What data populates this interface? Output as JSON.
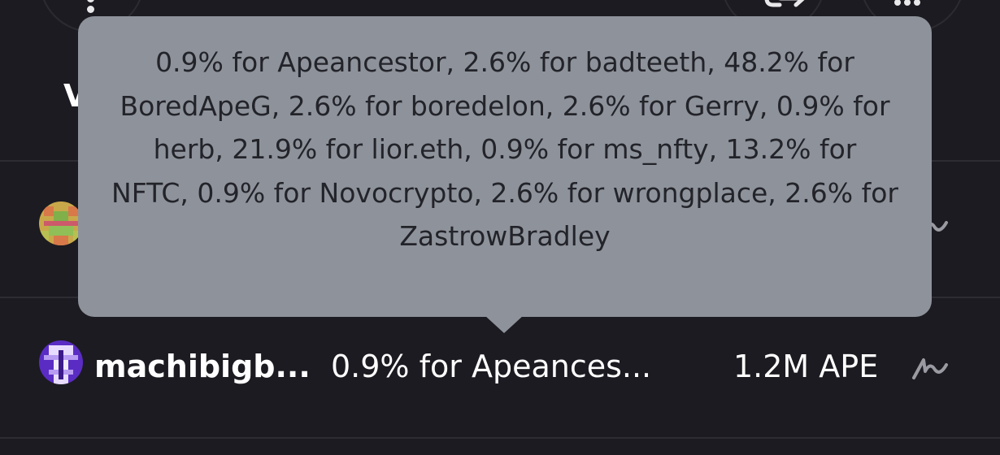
{
  "header": {
    "partial_label": "V"
  },
  "tooltip": {
    "text": "0.9% for Apeancestor, 2.6% for badteeth, 48.2% for BoredApeG, 2.6% for boredelon, 2.6% for Gerry, 0.9% for herb, 21.9% for lior.eth, 0.9% for ms_nfty, 13.2% for NFTC, 0.9% for Novocrypto, 2.6% for wrongplace, 2.6% for ZastrowBradley"
  },
  "rows": [
    {
      "avatar": "pixel-avatar-green",
      "name": "",
      "description": "",
      "amount": "",
      "signature_icon": "signature-icon"
    },
    {
      "avatar": "pixel-avatar-purple",
      "name": "machibigb...",
      "description": "0.9% for Apeances...",
      "amount": "1.2M APE",
      "signature_icon": "signature-icon"
    }
  ],
  "top_actions": {
    "left": "kebab-menu-icon",
    "middle": "share-icon",
    "right": "more-icon"
  },
  "colors": {
    "background": "#1c1b21",
    "tooltip_bg": "#8e939b",
    "tooltip_text": "#23232a",
    "divider": "#2d2c33",
    "text": "#ffffff"
  }
}
